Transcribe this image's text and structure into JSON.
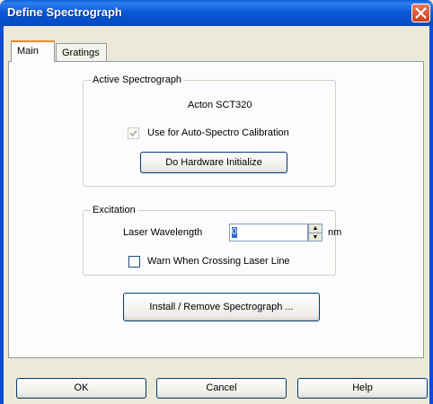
{
  "window": {
    "title": "Define Spectrograph"
  },
  "tabs": [
    {
      "label": "Main",
      "active": true
    },
    {
      "label": "Gratings",
      "active": false
    }
  ],
  "active_spectrograph": {
    "group_label": "Active Spectrograph",
    "model": "Acton SCT320",
    "auto_calibration_label": "Use for Auto-Spectro Calibration",
    "auto_calibration_checked": true,
    "auto_calibration_enabled": false,
    "initialize_button": "Do Hardware Initialize"
  },
  "excitation": {
    "group_label": "Excitation",
    "wavelength_label": "Laser Wavelength",
    "wavelength_value": "0",
    "unit": "nm",
    "warn_label": "Warn When Crossing Laser Line",
    "warn_checked": false
  },
  "install_button": "Install / Remove Spectrograph ...",
  "buttons": {
    "ok": "OK",
    "cancel": "Cancel",
    "help": "Help"
  }
}
